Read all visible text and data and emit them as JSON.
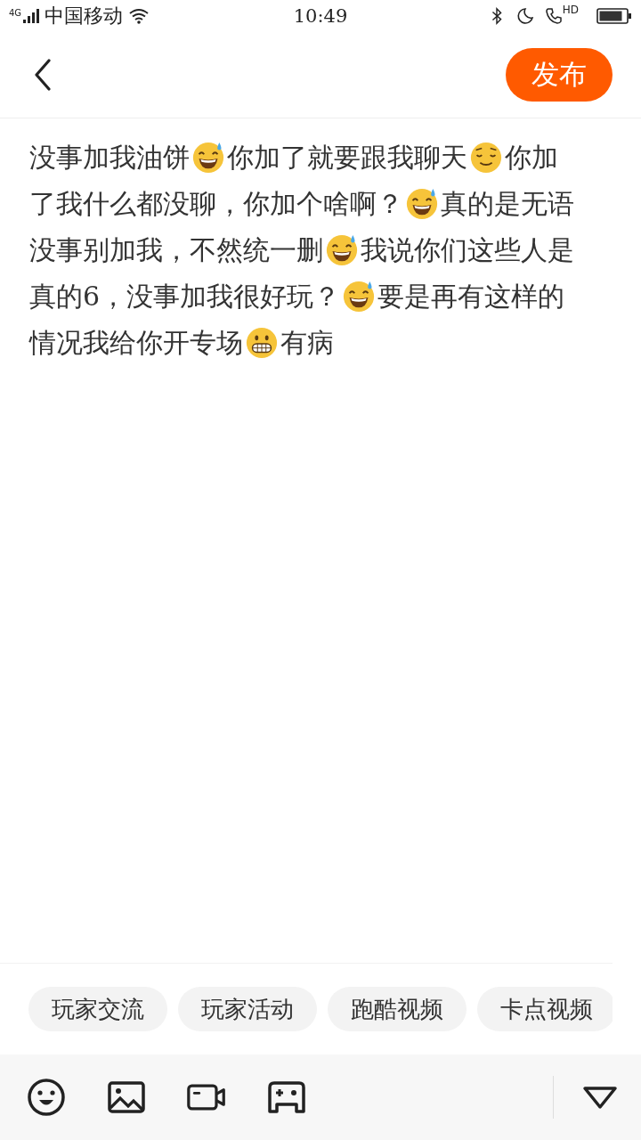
{
  "status_bar": {
    "network": "4G",
    "carrier": "中国移动",
    "time": "10:49",
    "call_badge": "HD"
  },
  "header": {
    "publish_button": "发布"
  },
  "post": {
    "lines": [
      [
        {
          "kind": "text",
          "text": "没事加我油饼"
        },
        {
          "kind": "sweat-smile"
        },
        {
          "kind": "text",
          "text": "你加了就要跟我聊天"
        },
        {
          "kind": "relieved"
        },
        {
          "kind": "text",
          "text": "你加"
        }
      ],
      [
        {
          "kind": "text",
          "text": "了我什么都没聊，你加个啥啊？"
        },
        {
          "kind": "sweat-smile"
        },
        {
          "kind": "text",
          "text": "真的是无语"
        }
      ],
      [
        {
          "kind": "text",
          "text": "没事别加我，不然统一删"
        },
        {
          "kind": "sweat-smile"
        },
        {
          "kind": "text",
          "text": "我说你们这些人是"
        }
      ],
      [
        {
          "kind": "text",
          "text": "真的6，没事加我很好玩？"
        },
        {
          "kind": "sweat-smile"
        },
        {
          "kind": "text",
          "text": "要是再有这样的"
        }
      ],
      [
        {
          "kind": "text",
          "text": "情况我给你开专场"
        },
        {
          "kind": "grin"
        },
        {
          "kind": "text",
          "text": "有病"
        }
      ]
    ]
  },
  "topic_tags": [
    {
      "label": "玩家交流"
    },
    {
      "label": "玩家活动"
    },
    {
      "label": "跑酷视频"
    },
    {
      "label": "卡点视频"
    }
  ],
  "toolbar": {
    "tools": [
      {
        "kind": "emoji"
      },
      {
        "kind": "image"
      },
      {
        "kind": "video"
      },
      {
        "kind": "game"
      }
    ]
  }
}
